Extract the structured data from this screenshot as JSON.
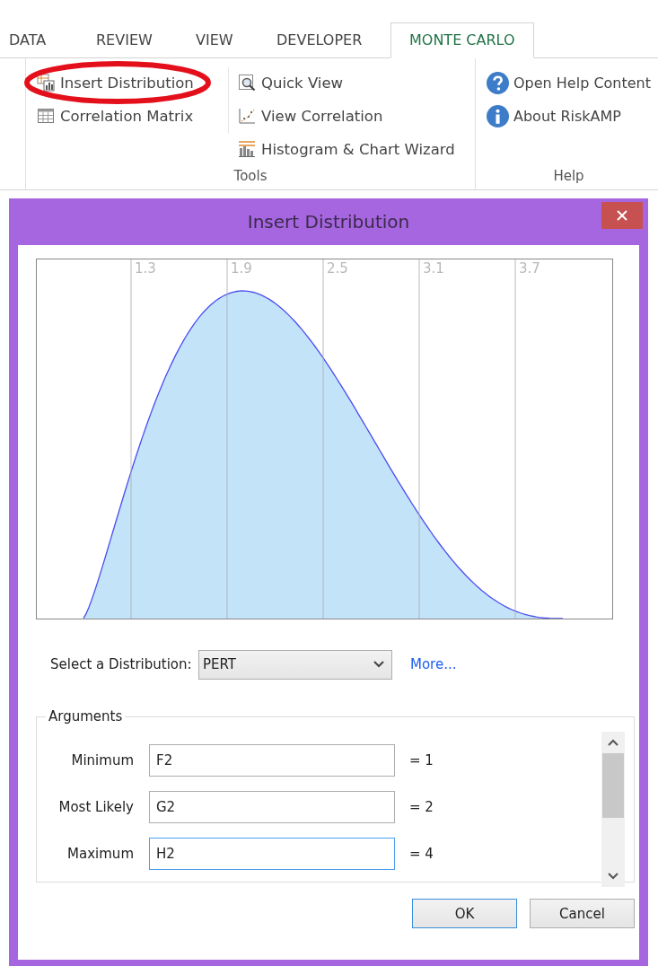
{
  "ribbon": {
    "tabs": [
      {
        "label": "DATA",
        "selected": false
      },
      {
        "label": "REVIEW",
        "selected": false
      },
      {
        "label": "VIEW",
        "selected": false
      },
      {
        "label": "DEVELOPER",
        "selected": false
      },
      {
        "label": "MONTE CARLO",
        "selected": true
      }
    ],
    "groups": [
      {
        "label": "Tools",
        "columns": [
          [
            {
              "kind": "insert",
              "label": "Insert Distribution",
              "circled": true
            },
            {
              "kind": "matrix",
              "label": "Correlation Matrix",
              "circled": false
            }
          ],
          [
            {
              "kind": "quickview",
              "label": "Quick View",
              "circled": false
            },
            {
              "kind": "correlation",
              "label": "View Correlation",
              "circled": false
            },
            {
              "kind": "histogram",
              "label": "Histogram & Chart Wizard",
              "circled": false
            }
          ]
        ]
      },
      {
        "label": "Help",
        "columns": [
          [
            {
              "kind": "help",
              "label": "Open Help Content",
              "circled": false
            },
            {
              "kind": "info",
              "label": "About RiskAMP",
              "circled": false
            }
          ]
        ]
      }
    ]
  },
  "dialog": {
    "title": "Insert Distribution",
    "chart": {
      "axis_labels": [
        "1.3",
        "1.9",
        "2.5",
        "3.1",
        "3.7"
      ]
    },
    "distribution": {
      "label": "Select a Distribution:",
      "value": "PERT",
      "link": "More..."
    },
    "arguments": {
      "legend": "Arguments",
      "rows": [
        {
          "label": "Minimum",
          "value": "F2",
          "result": "= 1",
          "focused": false
        },
        {
          "label": "Most Likely",
          "value": "G2",
          "result": "= 2",
          "focused": false
        },
        {
          "label": "Maximum",
          "value": "H2",
          "result": "= 4",
          "focused": true
        }
      ]
    },
    "buttons": [
      {
        "label": "OK",
        "default": true
      },
      {
        "label": "Cancel",
        "default": false
      }
    ]
  }
}
